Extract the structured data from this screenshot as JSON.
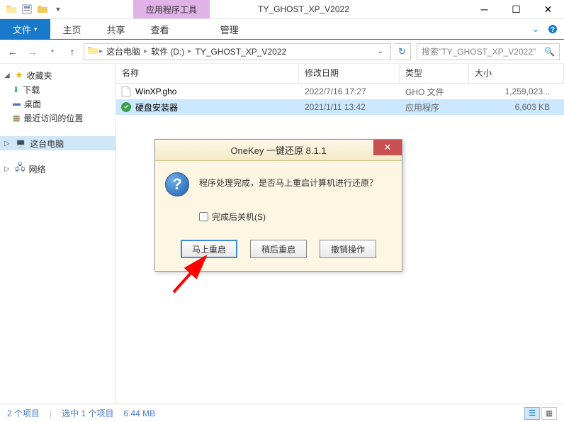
{
  "window": {
    "context_tab": "应用程序工具",
    "title": "TY_GHOST_XP_V2022"
  },
  "ribbon": {
    "file": "文件",
    "tabs": [
      "主页",
      "共享",
      "查看"
    ],
    "manage": "管理"
  },
  "breadcrumb": {
    "items": [
      "这台电脑",
      "软件 (D:)",
      "TY_GHOST_XP_V2022"
    ],
    "search_placeholder": "搜索\"TY_GHOST_XP_V2022\""
  },
  "sidebar": {
    "favorites": "收藏夹",
    "downloads": "下载",
    "desktop": "桌面",
    "recent": "最近访问的位置",
    "thispc": "这台电脑",
    "network": "网络"
  },
  "columns": {
    "name": "名称",
    "date": "修改日期",
    "type": "类型",
    "size": "大小"
  },
  "files": [
    {
      "name": "WinXP.gho",
      "date": "2022/7/16 17:27",
      "type": "GHO 文件",
      "size": "1,259,023...",
      "selected": false,
      "icon": "doc"
    },
    {
      "name": "硬盘安装器",
      "date": "2021/1/11 13:42",
      "type": "应用程序",
      "size": "6,603 KB",
      "selected": true,
      "icon": "app"
    }
  ],
  "dialog": {
    "title": "OneKey 一键还原 8.1.1",
    "message": "程序处理完成，是否马上重启计算机进行还原？",
    "checkbox": "完成后关机(S)",
    "buttons": {
      "restart_now": "马上重启",
      "restart_later": "稍后重启",
      "cancel": "撤销操作"
    }
  },
  "status": {
    "items": "2 个项目",
    "selected": "选中 1 个项目",
    "size": "6.44 MB"
  }
}
